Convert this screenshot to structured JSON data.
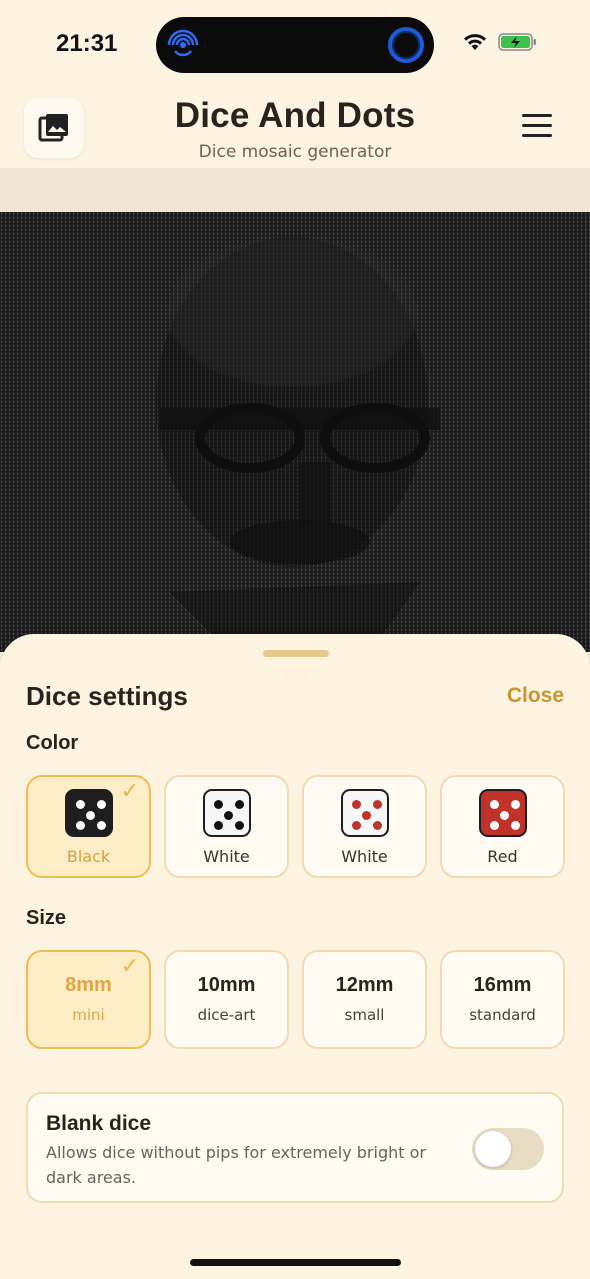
{
  "status": {
    "time": "21:31"
  },
  "header": {
    "title": "Dice And Dots",
    "subtitle": "Dice mosaic generator"
  },
  "sheet": {
    "title": "Dice settings",
    "close_label": "Close",
    "color_section": {
      "label": "Color",
      "options": [
        {
          "label": "Black",
          "die_color": "#1e1e1e",
          "pip_color": "#ffffff",
          "selected": true
        },
        {
          "label": "White",
          "die_color": "#f7f7f7",
          "pip_color": "#111111",
          "selected": false
        },
        {
          "label": "White",
          "die_color": "#f7f7f7",
          "pip_color": "#c0332b",
          "selected": false
        },
        {
          "label": "Red",
          "die_color": "#c0332b",
          "pip_color": "#ffffff",
          "selected": false
        }
      ]
    },
    "size_section": {
      "label": "Size",
      "options": [
        {
          "size": "8mm",
          "desc": "mini",
          "selected": true
        },
        {
          "size": "10mm",
          "desc": "dice-art",
          "selected": false
        },
        {
          "size": "12mm",
          "desc": "small",
          "selected": false
        },
        {
          "size": "16mm",
          "desc": "standard",
          "selected": false
        }
      ]
    },
    "blank_dice": {
      "title": "Blank dice",
      "description": "Allows dice without pips for extremely bright or dark areas.",
      "enabled": false
    }
  },
  "colors": {
    "accent": "#c9952d",
    "background": "#fdf3e1",
    "selected_border": "#f0bd55"
  }
}
